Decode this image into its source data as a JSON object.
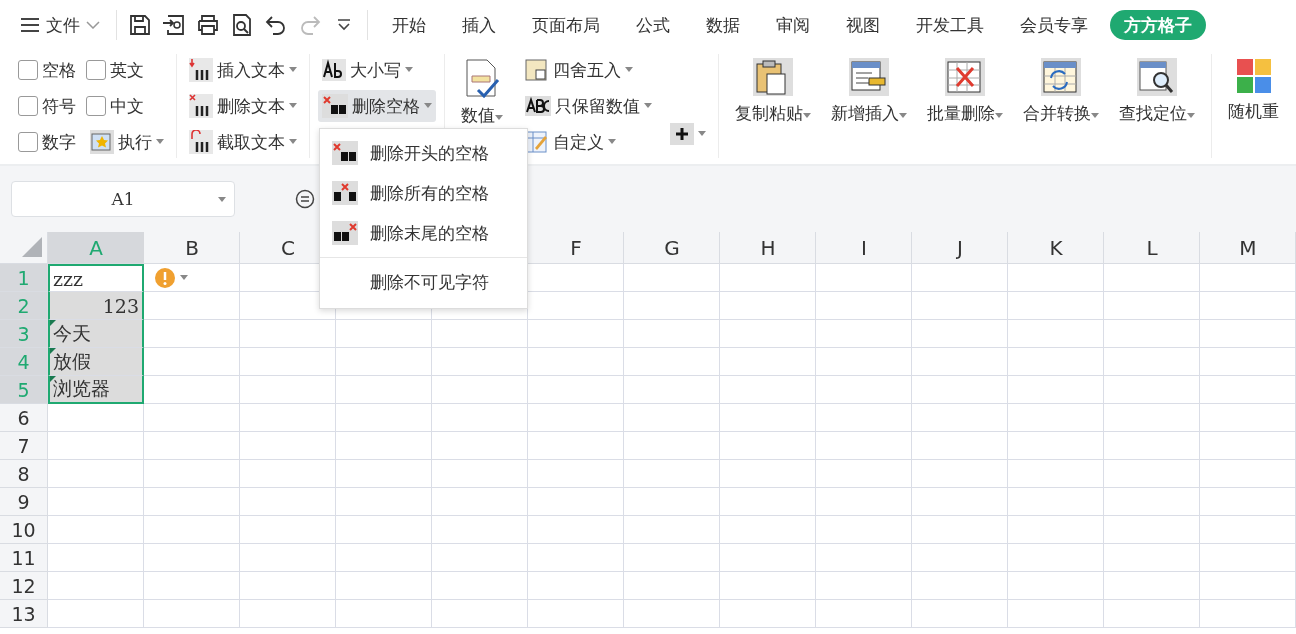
{
  "menu_bar": {
    "file_menu": "文件",
    "tabs": [
      {
        "label": "开始",
        "selected": false
      },
      {
        "label": "插入",
        "selected": false
      },
      {
        "label": "页面布局",
        "selected": false
      },
      {
        "label": "公式",
        "selected": false
      },
      {
        "label": "数据",
        "selected": false
      },
      {
        "label": "审阅",
        "selected": false
      },
      {
        "label": "视图",
        "selected": false
      },
      {
        "label": "开发工具",
        "selected": false
      },
      {
        "label": "会员专享",
        "selected": false
      },
      {
        "label": "方方格子",
        "selected": true
      }
    ]
  },
  "ribbon": {
    "checkboxes": [
      {
        "label": "空格",
        "checked": false
      },
      {
        "label": "英文",
        "checked": false
      },
      {
        "label": "符号",
        "checked": false
      },
      {
        "label": "中文",
        "checked": false
      },
      {
        "label": "数字",
        "checked": false
      }
    ],
    "execute_button": "执行",
    "text_buttons": [
      {
        "label": "插入文本",
        "kind": "insert"
      },
      {
        "label": "删除文本",
        "kind": "delete"
      },
      {
        "label": "截取文本",
        "kind": "cut"
      }
    ],
    "case_button": "大小写",
    "trim_button": {
      "label": "删除空格",
      "expanded": true
    },
    "number_button": "数值",
    "number_buttons": [
      {
        "label": "四舍五入",
        "kind": "round"
      },
      {
        "label": "只保留数值",
        "kind": "keep"
      },
      {
        "label": "自定义",
        "kind": "custom"
      }
    ],
    "big_buttons": [
      {
        "label": "复制粘贴",
        "kind": "clipboard"
      },
      {
        "label": "新增插入",
        "kind": "insert"
      },
      {
        "label": "批量删除",
        "kind": "delete"
      },
      {
        "label": "合并转换",
        "kind": "convert"
      },
      {
        "label": "查找定位",
        "kind": "find"
      }
    ],
    "cut_button": "随机重"
  },
  "dropdown": {
    "items": [
      {
        "label": "删除开头的空格",
        "kind": "leading"
      },
      {
        "label": "删除所有的空格",
        "kind": "all"
      },
      {
        "label": "删除末尾的空格",
        "kind": "trailing"
      },
      {
        "label": "删除不可见字符",
        "kind": "plain"
      }
    ]
  },
  "name_box": "A1",
  "sheet": {
    "columns": [
      {
        "label": "A",
        "selected": true
      },
      {
        "label": "B",
        "selected": false
      },
      {
        "label": "C",
        "selected": false
      },
      null,
      null,
      {
        "label": "F",
        "selected": false
      },
      {
        "label": "G",
        "selected": false
      },
      {
        "label": "H",
        "selected": false
      },
      {
        "label": "I",
        "selected": false
      },
      {
        "label": "J",
        "selected": false
      },
      {
        "label": "K",
        "selected": false
      },
      {
        "label": "L",
        "selected": false
      },
      {
        "label": "M",
        "selected": false
      }
    ],
    "rows": [
      {
        "label": "1",
        "selected": true,
        "warning": true,
        "cells": [
          {
            "text": "zzz",
            "kind": "text",
            "flagged": false,
            "active": true
          }
        ]
      },
      {
        "label": "2",
        "selected": true,
        "warning": false,
        "cells": [
          {
            "text": "123",
            "kind": "number",
            "flagged": false,
            "active": false
          }
        ]
      },
      {
        "label": "3",
        "selected": true,
        "warning": false,
        "cells": [
          {
            "text": "今天",
            "kind": "text",
            "flagged": true,
            "active": false
          }
        ]
      },
      {
        "label": "4",
        "selected": true,
        "warning": false,
        "cells": [
          {
            "text": "放假",
            "kind": "text",
            "flagged": true,
            "active": false
          }
        ]
      },
      {
        "label": "5",
        "selected": true,
        "warning": false,
        "cells": [
          {
            "text": "浏览器",
            "kind": "text",
            "flagged": true,
            "active": false
          }
        ]
      },
      {
        "label": "6",
        "selected": false,
        "warning": false,
        "cells": []
      },
      {
        "label": "7",
        "selected": false,
        "warning": false,
        "cells": []
      },
      {
        "label": "8",
        "selected": false,
        "warning": false,
        "cells": []
      },
      {
        "label": "9",
        "selected": false,
        "warning": false,
        "cells": []
      },
      {
        "label": "10",
        "selected": false,
        "warning": false,
        "cells": []
      },
      {
        "label": "11",
        "selected": false,
        "warning": false,
        "cells": []
      },
      {
        "label": "12",
        "selected": false,
        "warning": false,
        "cells": []
      },
      {
        "label": "13",
        "selected": false,
        "warning": false,
        "cells": []
      }
    ]
  }
}
